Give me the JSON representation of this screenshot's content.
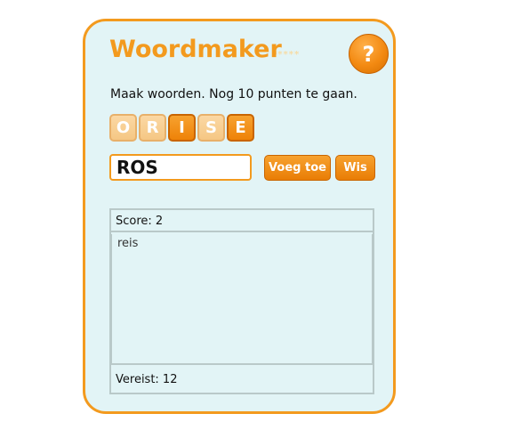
{
  "game": {
    "title": "Woordmaker",
    "stars": {
      "filled": 1,
      "total": 5
    },
    "help_label": "?",
    "instruction": "Maak woorden. Nog 10 punten te gaan.",
    "tiles": [
      {
        "letter": "O",
        "used": true
      },
      {
        "letter": "R",
        "used": true
      },
      {
        "letter": "I",
        "used": false
      },
      {
        "letter": "S",
        "used": true
      },
      {
        "letter": "E",
        "used": false
      }
    ],
    "current_word": "ROS",
    "add_label": "Voeg toe",
    "clear_label": "Wis",
    "score_text": "Score: 2",
    "words": [
      "reis"
    ],
    "required_text": "Vereist: 12"
  },
  "colors": {
    "accent": "#f39a1e",
    "panel_bg": "#e2f4f6",
    "tile_used": "#f5c784",
    "tile_free": "#ee8208"
  }
}
